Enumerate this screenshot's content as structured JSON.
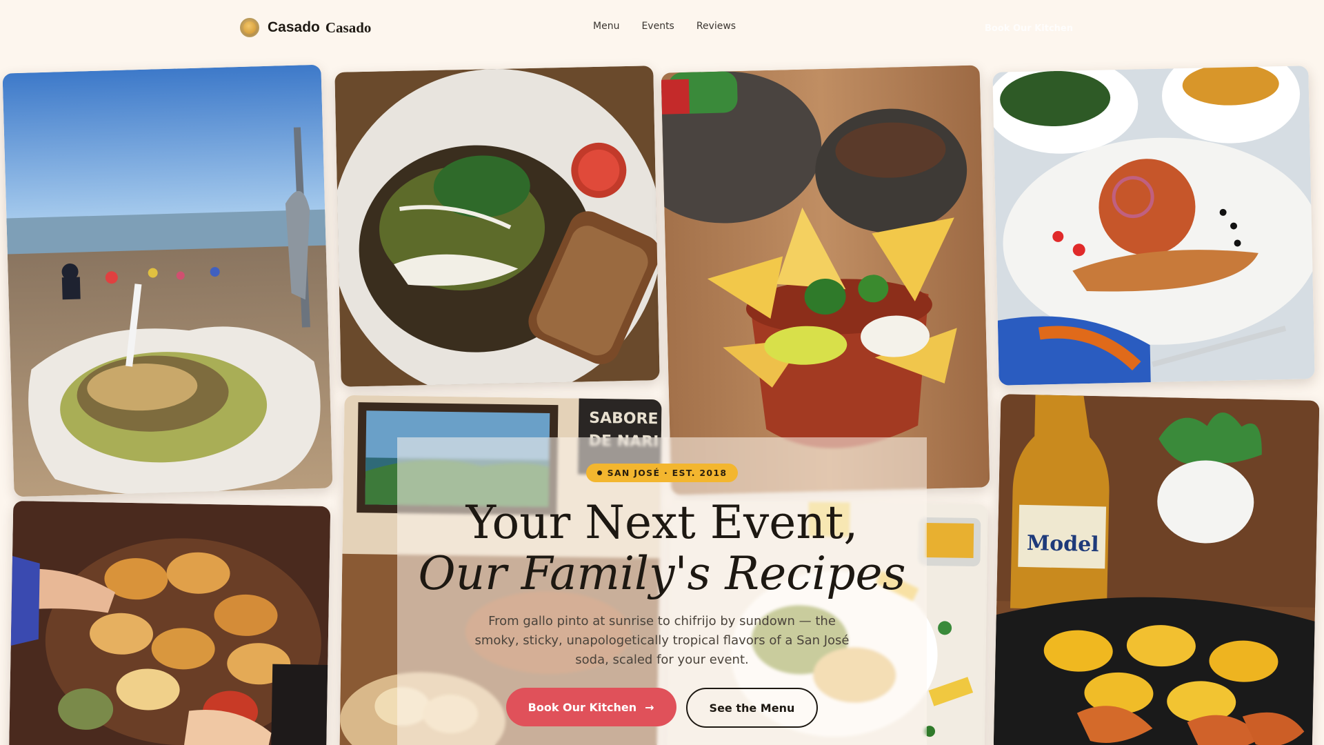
{
  "brand": {
    "name": "Casado",
    "name_serif": "Casado"
  },
  "nav": {
    "items": [
      {
        "label": "Menu"
      },
      {
        "label": "Events"
      },
      {
        "label": "Reviews"
      }
    ]
  },
  "header_cta": {
    "label": "Book Our Kitchen"
  },
  "hero": {
    "badge": "SAN JOSÉ · EST. 2018",
    "title_line1": "Your Next Event,",
    "title_line2": "Our Family's Recipes",
    "subtitle": "From gallo pinto at sunrise to chifrijo by sundown — the smoky, sticky, unapologetically tropical flavors of a San José soda, scaled for your event.",
    "primary_cta": "Book Our Kitchen",
    "secondary_cta": "See the Menu"
  },
  "colors": {
    "background": "#fdf6ee",
    "accent_red": "#e0515a",
    "badge_yellow": "#f3b62f",
    "text_dark": "#1d1812"
  },
  "collage": [
    {
      "subject": "beach-food-photo"
    },
    {
      "subject": "rice-beans-plate-photo"
    },
    {
      "subject": "nachos-molcajete-photo"
    },
    {
      "subject": "rice-fish-plate-photo"
    },
    {
      "subject": "restaurant-interior-photo"
    },
    {
      "subject": "empanadas-table-photo"
    },
    {
      "subject": "buffet-spread-photo"
    },
    {
      "subject": "beer-patacones-shrimp-photo"
    }
  ]
}
